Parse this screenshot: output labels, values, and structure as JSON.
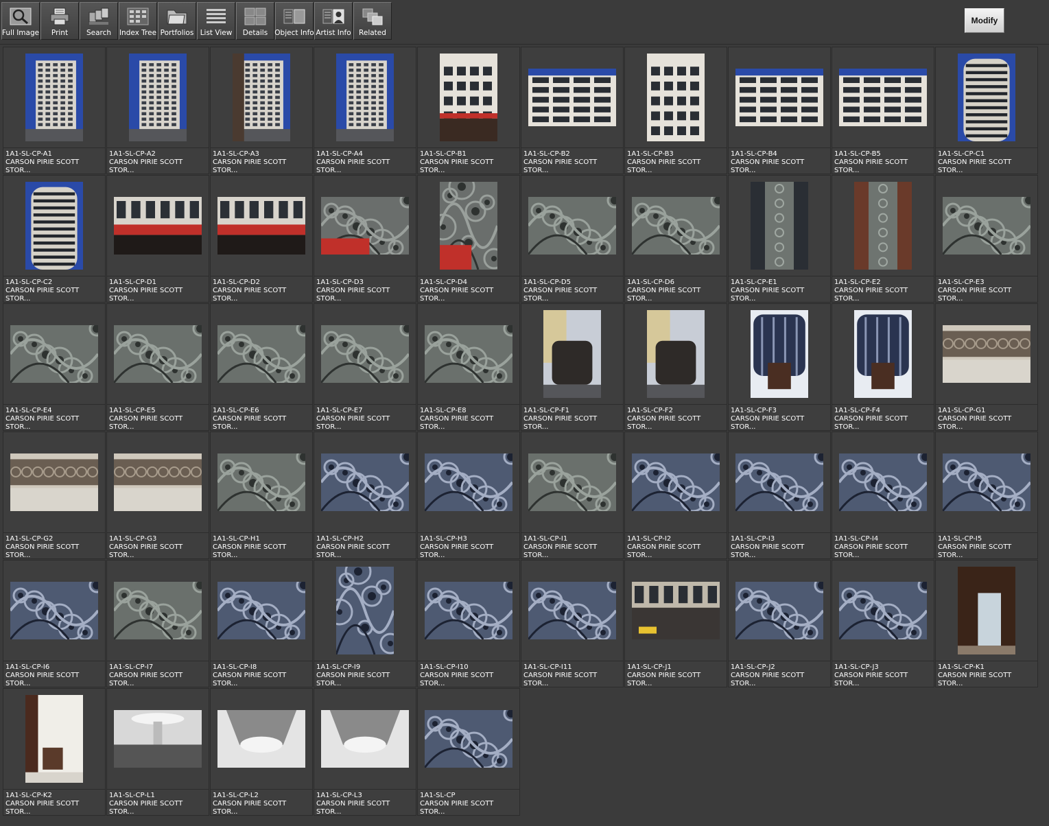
{
  "toolbar": {
    "buttons": [
      {
        "label": "Full Image",
        "icon": "magnifier-icon"
      },
      {
        "label": "Print",
        "icon": "printer-icon"
      },
      {
        "label": "Search",
        "icon": "search-cards-icon"
      },
      {
        "label": "Index Tree",
        "icon": "index-tree-icon"
      },
      {
        "label": "Portfolios",
        "icon": "folder-icon"
      },
      {
        "label": "List View",
        "icon": "list-view-icon"
      },
      {
        "label": "Details",
        "icon": "details-grid-icon"
      },
      {
        "label": "Object Info",
        "icon": "object-info-icon"
      },
      {
        "label": "Artist Info",
        "icon": "artist-info-icon"
      },
      {
        "label": "Related",
        "icon": "related-icon"
      }
    ],
    "modify_label": "Modify"
  },
  "colors": {
    "background": "#3b3b3b",
    "cell": "#3e3e3e",
    "sky": "#2a4aa8",
    "ironwork": "#5a6468",
    "awning": "#c0302a"
  },
  "items": [
    {
      "id": "1A1-SL-CP-A1",
      "line2": "CARSON PIRIE SCOTT",
      "line3": "STOR...",
      "orient": "portrait",
      "kind": "tower"
    },
    {
      "id": "1A1-SL-CP-A2",
      "line2": "CARSON PIRIE SCOTT",
      "line3": "STOR...",
      "orient": "portrait",
      "kind": "tower"
    },
    {
      "id": "1A1-SL-CP-A3",
      "line2": "CARSON PIRIE SCOTT",
      "line3": "STOR...",
      "orient": "portrait",
      "kind": "street"
    },
    {
      "id": "1A1-SL-CP-A4",
      "line2": "CARSON PIRIE SCOTT",
      "line3": "STOR...",
      "orient": "portrait",
      "kind": "tower"
    },
    {
      "id": "1A1-SL-CP-B1",
      "line2": "CARSON PIRIE SCOTT",
      "line3": "STOR...",
      "orient": "portrait",
      "kind": "facade"
    },
    {
      "id": "1A1-SL-CP-B2",
      "line2": "CARSON PIRIE SCOTT",
      "line3": "STOR...",
      "orient": "landscape",
      "kind": "windows"
    },
    {
      "id": "1A1-SL-CP-B3",
      "line2": "CARSON PIRIE SCOTT",
      "line3": "STOR...",
      "orient": "portrait",
      "kind": "windows"
    },
    {
      "id": "1A1-SL-CP-B4",
      "line2": "CARSON PIRIE SCOTT",
      "line3": "STOR...",
      "orient": "landscape",
      "kind": "windows"
    },
    {
      "id": "1A1-SL-CP-B5",
      "line2": "CARSON PIRIE SCOTT",
      "line3": "STOR...",
      "orient": "landscape",
      "kind": "windows"
    },
    {
      "id": "1A1-SL-CP-C1",
      "line2": "CARSON PIRIE SCOTT",
      "line3": "STOR...",
      "orient": "portrait",
      "kind": "rotunda"
    },
    {
      "id": "1A1-SL-CP-C2",
      "line2": "CARSON PIRIE SCOTT",
      "line3": "STOR...",
      "orient": "portrait",
      "kind": "rotunda"
    },
    {
      "id": "1A1-SL-CP-D1",
      "line2": "CARSON PIRIE SCOTT",
      "line3": "STOR...",
      "orient": "landscape",
      "kind": "awning"
    },
    {
      "id": "1A1-SL-CP-D2",
      "line2": "CARSON PIRIE SCOTT",
      "line3": "STOR...",
      "orient": "landscape",
      "kind": "awning"
    },
    {
      "id": "1A1-SL-CP-D3",
      "line2": "CARSON PIRIE SCOTT",
      "line3": "STOR...",
      "orient": "landscape",
      "kind": "ironred"
    },
    {
      "id": "1A1-SL-CP-D4",
      "line2": "CARSON PIRIE SCOTT",
      "line3": "STOR...",
      "orient": "portrait",
      "kind": "ironred"
    },
    {
      "id": "1A1-SL-CP-D5",
      "line2": "CARSON PIRIE SCOTT",
      "line3": "STOR...",
      "orient": "landscape",
      "kind": "iron"
    },
    {
      "id": "1A1-SL-CP-D6",
      "line2": "CARSON PIRIE SCOTT",
      "line3": "STOR...",
      "orient": "landscape",
      "kind": "iron"
    },
    {
      "id": "1A1-SL-CP-E1",
      "line2": "CARSON PIRIE SCOTT",
      "line3": "STOR...",
      "orient": "portrait",
      "kind": "pier"
    },
    {
      "id": "1A1-SL-CP-E2",
      "line2": "CARSON PIRIE SCOTT",
      "line3": "STOR...",
      "orient": "portrait",
      "kind": "pierbrick"
    },
    {
      "id": "1A1-SL-CP-E3",
      "line2": "CARSON PIRIE SCOTT",
      "line3": "STOR...",
      "orient": "landscape",
      "kind": "iron"
    },
    {
      "id": "1A1-SL-CP-E4",
      "line2": "CARSON PIRIE SCOTT",
      "line3": "STOR...",
      "orient": "landscape",
      "kind": "iron"
    },
    {
      "id": "1A1-SL-CP-E5",
      "line2": "CARSON PIRIE SCOTT",
      "line3": "STOR...",
      "orient": "landscape",
      "kind": "iron"
    },
    {
      "id": "1A1-SL-CP-E6",
      "line2": "CARSON PIRIE SCOTT",
      "line3": "STOR...",
      "orient": "landscape",
      "kind": "iron"
    },
    {
      "id": "1A1-SL-CP-E7",
      "line2": "CARSON PIRIE SCOTT",
      "line3": "STOR...",
      "orient": "landscape",
      "kind": "iron"
    },
    {
      "id": "1A1-SL-CP-E8",
      "line2": "CARSON PIRIE SCOTT",
      "line3": "STOR...",
      "orient": "landscape",
      "kind": "iron"
    },
    {
      "id": "1A1-SL-CP-F1",
      "line2": "CARSON PIRIE SCOTT",
      "line3": "STOR...",
      "orient": "portrait",
      "kind": "corner"
    },
    {
      "id": "1A1-SL-CP-F2",
      "line2": "CARSON PIRIE SCOTT",
      "line3": "STOR...",
      "orient": "portrait",
      "kind": "corner"
    },
    {
      "id": "1A1-SL-CP-F3",
      "line2": "CARSON PIRIE SCOTT",
      "line3": "STOR...",
      "orient": "portrait",
      "kind": "entrance"
    },
    {
      "id": "1A1-SL-CP-F4",
      "line2": "CARSON PIRIE SCOTT",
      "line3": "STOR...",
      "orient": "portrait",
      "kind": "entrance"
    },
    {
      "id": "1A1-SL-CP-G1",
      "line2": "CARSON PIRIE SCOTT",
      "line3": "STOR...",
      "orient": "landscape",
      "kind": "frieze"
    },
    {
      "id": "1A1-SL-CP-G2",
      "line2": "CARSON PIRIE SCOTT",
      "line3": "STOR...",
      "orient": "landscape",
      "kind": "frieze"
    },
    {
      "id": "1A1-SL-CP-G3",
      "line2": "CARSON PIRIE SCOTT",
      "line3": "STOR...",
      "orient": "landscape",
      "kind": "frieze"
    },
    {
      "id": "1A1-SL-CP-H1",
      "line2": "CARSON PIRIE SCOTT",
      "line3": "STOR...",
      "orient": "landscape",
      "kind": "iron"
    },
    {
      "id": "1A1-SL-CP-H2",
      "line2": "CARSON PIRIE SCOTT",
      "line3": "STOR...",
      "orient": "landscape",
      "kind": "ironblue"
    },
    {
      "id": "1A1-SL-CP-H3",
      "line2": "CARSON PIRIE SCOTT",
      "line3": "STOR...",
      "orient": "landscape",
      "kind": "ironblue"
    },
    {
      "id": "1A1-SL-CP-I1",
      "line2": "CARSON PIRIE SCOTT",
      "line3": "STOR...",
      "orient": "landscape",
      "kind": "iron"
    },
    {
      "id": "1A1-SL-CP-I2",
      "line2": "CARSON PIRIE SCOTT",
      "line3": "STOR...",
      "orient": "landscape",
      "kind": "ironblue"
    },
    {
      "id": "1A1-SL-CP-I3",
      "line2": "CARSON PIRIE SCOTT",
      "line3": "STOR...",
      "orient": "landscape",
      "kind": "ironblue"
    },
    {
      "id": "1A1-SL-CP-I4",
      "line2": "CARSON PIRIE SCOTT",
      "line3": "STOR...",
      "orient": "landscape",
      "kind": "ironblue"
    },
    {
      "id": "1A1-SL-CP-I5",
      "line2": "CARSON PIRIE SCOTT",
      "line3": "STOR...",
      "orient": "landscape",
      "kind": "ironblue"
    },
    {
      "id": "1A1-SL-CP-I6",
      "line2": "CARSON PIRIE SCOTT",
      "line3": "STOR...",
      "orient": "landscape",
      "kind": "ironblue"
    },
    {
      "id": "1A1-SL-CP-I7",
      "line2": "CARSON PIRIE SCOTT",
      "line3": "STOR...",
      "orient": "landscape",
      "kind": "iron"
    },
    {
      "id": "1A1-SL-CP-I8",
      "line2": "CARSON PIRIE SCOTT",
      "line3": "STOR...",
      "orient": "landscape",
      "kind": "ironblue"
    },
    {
      "id": "1A1-SL-CP-I9",
      "line2": "CARSON PIRIE SCOTT",
      "line3": "STOR...",
      "orient": "portrait",
      "kind": "ironblue"
    },
    {
      "id": "1A1-SL-CP-I10",
      "line2": "CARSON PIRIE SCOTT",
      "line3": "STOR...",
      "orient": "landscape",
      "kind": "ironblue"
    },
    {
      "id": "1A1-SL-CP-I11",
      "line2": "CARSON PIRIE SCOTT",
      "line3": "STOR...",
      "orient": "landscape",
      "kind": "ironblue"
    },
    {
      "id": "1A1-SL-CP-J1",
      "line2": "CARSON PIRIE SCOTT",
      "line3": "STOR...",
      "orient": "landscape",
      "kind": "storefront"
    },
    {
      "id": "1A1-SL-CP-J2",
      "line2": "CARSON PIRIE SCOTT",
      "line3": "STOR...",
      "orient": "landscape",
      "kind": "ironblue"
    },
    {
      "id": "1A1-SL-CP-J3",
      "line2": "CARSON PIRIE SCOTT",
      "line3": "STOR...",
      "orient": "landscape",
      "kind": "ironblue"
    },
    {
      "id": "1A1-SL-CP-K1",
      "line2": "CARSON PIRIE SCOTT",
      "line3": "STOR...",
      "orient": "portrait",
      "kind": "interior"
    },
    {
      "id": "1A1-SL-CP-K2",
      "line2": "CARSON PIRIE SCOTT",
      "line3": "STOR...",
      "orient": "portrait",
      "kind": "interiorwhite"
    },
    {
      "id": "1A1-SL-CP-L1",
      "line2": "CARSON PIRIE SCOTT",
      "line3": "STOR...",
      "orient": "landscape",
      "kind": "bwinterior"
    },
    {
      "id": "1A1-SL-CP-L2",
      "line2": "CARSON PIRIE SCOTT",
      "line3": "STOR...",
      "orient": "landscape",
      "kind": "bwdome"
    },
    {
      "id": "1A1-SL-CP-L3",
      "line2": "CARSON PIRIE SCOTT",
      "line3": "STOR...",
      "orient": "landscape",
      "kind": "bwdome2"
    },
    {
      "id": "1A1-SL-CP",
      "line2": "CARSON PIRIE SCOTT",
      "line3": "STOR...",
      "orient": "landscape",
      "kind": "ironblue"
    }
  ]
}
